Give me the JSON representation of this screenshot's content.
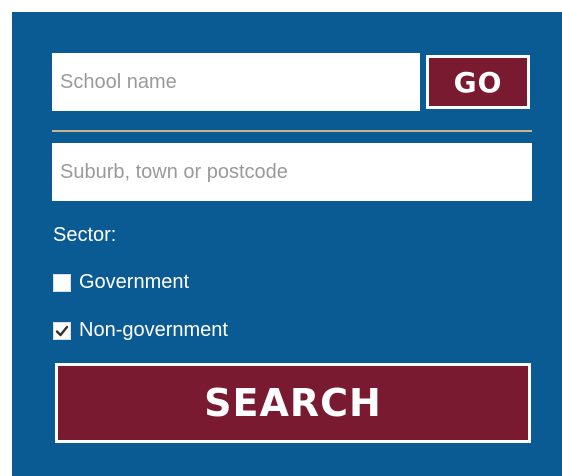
{
  "school_search": {
    "name_placeholder": "School name",
    "go_label": "GO"
  },
  "location": {
    "placeholder": "Suburb, town or postcode"
  },
  "sector": {
    "label": "Sector:",
    "options": [
      {
        "label": "Government",
        "checked": false
      },
      {
        "label": "Non-government",
        "checked": true
      }
    ]
  },
  "search_label": "SEARCH",
  "colors": {
    "panel": "#0a5a93",
    "button": "#7a1a30",
    "divider": "#c9b58a"
  },
  "icons": {
    "checkmark": "checkmark-icon"
  }
}
